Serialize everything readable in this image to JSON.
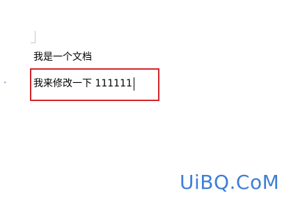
{
  "document": {
    "line1": "我是一个文档",
    "line2": "我来修改一下 111111"
  },
  "watermark": {
    "text": "UiBQ.CoM",
    "color": "#3d7fd6"
  },
  "highlight": {
    "color": "#d2232a"
  },
  "icons": {
    "corner_marker": "margin-corner-icon",
    "left_marker": "tab-marker-icon"
  }
}
